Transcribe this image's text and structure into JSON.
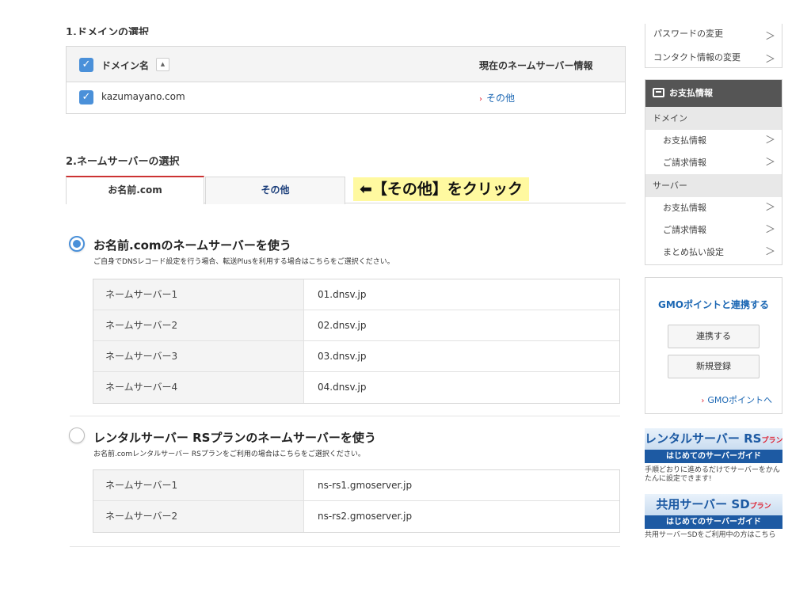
{
  "top_section": {
    "title_cut": "1.ドメインの選択"
  },
  "domain_table": {
    "header_label": "ドメイン名",
    "sort_glyph": "▲",
    "header_right": "現在のネームサーバー情報",
    "row": {
      "domain": "kazumayano.com",
      "other_arrow": "›",
      "other_label": "その他"
    }
  },
  "ns_section": {
    "title": "2.ネームサーバーの選択"
  },
  "tabs": [
    {
      "label": "お名前.com",
      "active": true
    },
    {
      "label": "その他",
      "active": false
    }
  ],
  "annotation": "⬅【その他】をクリック",
  "option1": {
    "title": "お名前.comのネームサーバーを使う",
    "desc": "ご自身でDNSレコード設定を行う場合、転送Plusを利用する場合はこちらをご選択ください。",
    "rows": [
      {
        "label": "ネームサーバー1",
        "value": "01.dnsv.jp"
      },
      {
        "label": "ネームサーバー2",
        "value": "02.dnsv.jp"
      },
      {
        "label": "ネームサーバー3",
        "value": "03.dnsv.jp"
      },
      {
        "label": "ネームサーバー4",
        "value": "04.dnsv.jp"
      }
    ]
  },
  "option2": {
    "title": "レンタルサーバー RSプランのネームサーバーを使う",
    "desc": "お名前.comレンタルサーバー RSプランをご利用の場合はこちらをご選択ください。",
    "rows": [
      {
        "label": "ネームサーバー1",
        "value": "ns-rs1.gmoserver.jp"
      },
      {
        "label": "ネームサーバー2",
        "value": "ns-rs2.gmoserver.jp"
      }
    ]
  },
  "sidebar": {
    "top_links": [
      "パスワードの変更",
      "コンタクト情報の変更"
    ],
    "payment": {
      "header": "お支払情報",
      "domain_cat": "ドメイン",
      "domain_items": [
        "お支払情報",
        "ご請求情報"
      ],
      "server_cat": "サーバー",
      "server_items": [
        "お支払情報",
        "ご請求情報",
        "まとめ払い設定"
      ]
    },
    "gmo": {
      "title": "GMOポイントと連携する",
      "link_button": "連携する",
      "register_button": "新規登録",
      "link_arrow": "›",
      "link_text": "GMOポイントへ"
    },
    "banner_rs": {
      "main": "レンタルサーバー RS",
      "suffix": "プラン",
      "sub": "はじめてのサーバーガイド",
      "note": "手順どおりに進めるだけでサーバーをかんたんに設定できます!"
    },
    "banner_sd": {
      "main": "共用サーバー SD",
      "suffix": "プラン",
      "sub": "はじめてのサーバーガイド",
      "note": "共用サーバーSDをご利用中の方はこちら"
    }
  },
  "chevron": "＞"
}
